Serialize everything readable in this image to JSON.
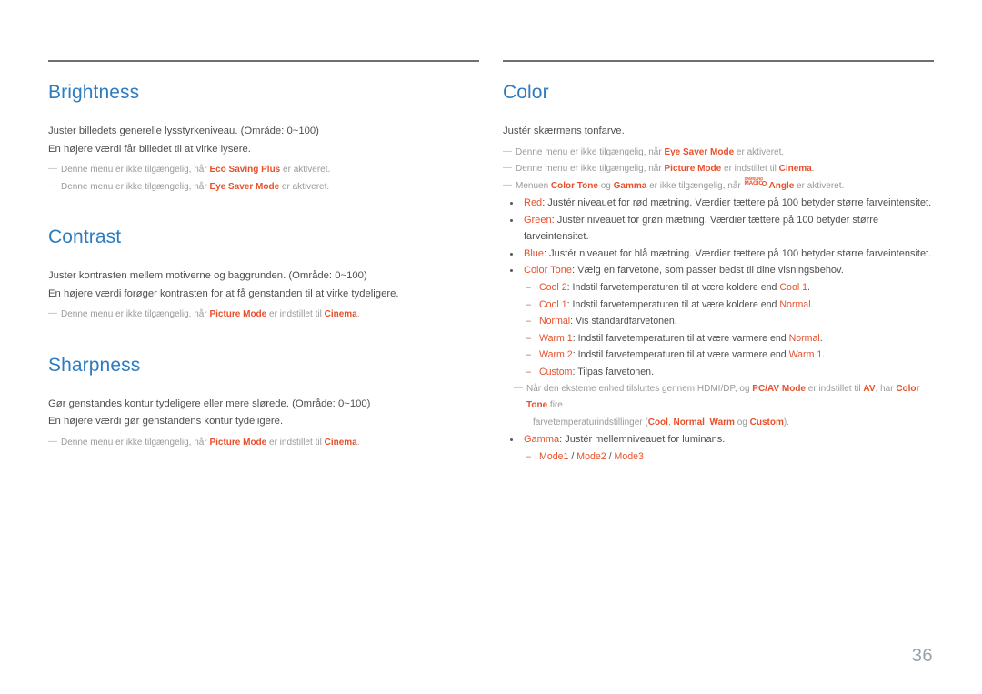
{
  "page": {
    "number": "36",
    "accent_blue": "#2e7cc0",
    "accent_orange": "#e8502b",
    "rule_color": "#6d6f71",
    "body_color": "#4f4f4f",
    "note_color": "#9a9a9a"
  },
  "left_column": {
    "sections": [
      {
        "title": "Brightness",
        "body": [
          "Juster billedets generelle lysstyrkeniveau. (Område: 0~100)",
          "En højere værdi får billedet til at virke lysere."
        ],
        "notes": [
          {
            "pre": "Denne menu er ikke tilgængelig, når ",
            "term1": "Eco Saving Plus",
            "post": " er aktiveret."
          },
          {
            "pre": "Denne menu er ikke tilgængelig, når ",
            "term1": "Eye Saver Mode",
            "post": " er aktiveret."
          }
        ]
      },
      {
        "title": "Contrast",
        "body": [
          "Juster kontrasten mellem motiverne og baggrunden. (Område: 0~100)",
          "En højere værdi forøger kontrasten for at få genstanden til at virke tydeligere."
        ],
        "notes": [
          {
            "pre": "Denne menu er ikke tilgængelig, når ",
            "term1": "Picture Mode",
            "mid": " er indstillet til ",
            "term2": "Cinema",
            "post": "."
          }
        ]
      },
      {
        "title": "Sharpness",
        "body": [
          "Gør genstandes kontur tydeligere eller mere slørede. (Område: 0~100)",
          "En højere værdi gør genstandens kontur tydeligere."
        ],
        "notes": [
          {
            "pre": "Denne menu er ikke tilgængelig, når ",
            "term1": "Picture Mode",
            "mid": " er indstillet til ",
            "term2": "Cinema",
            "post": "."
          }
        ]
      }
    ]
  },
  "right_column": {
    "title": "Color",
    "intro": "Justér skærmens tonfarve.",
    "notes": [
      {
        "pre": "Denne menu er ikke tilgængelig, når ",
        "term1": "Eye Saver Mode",
        "post": " er aktiveret."
      },
      {
        "pre": "Denne menu er ikke tilgængelig, når ",
        "term1": "Picture Mode",
        "mid": " er indstillet til ",
        "term2": "Cinema",
        "post": "."
      },
      {
        "pre": "Menuen ",
        "term1": "Color Tone",
        "mid": " og ",
        "term2": "Gamma",
        "mid2": " er ikke tilgængelig, når ",
        "logo_top": "SAMSUNG",
        "logo_bottom": "MAGIC",
        "term3": "Angle",
        "post": " er aktiveret."
      }
    ],
    "bullets": [
      {
        "term": "Red",
        "text": ": Justér niveauet for rød mætning. Værdier tættere på 100 betyder større farveintensitet."
      },
      {
        "term": "Green",
        "text": ": Justér niveauet for grøn mætning. Værdier tættere på 100 betyder større farveintensitet."
      },
      {
        "term": "Blue",
        "text": ": Justér niveauet for blå mætning. Værdier tættere på 100 betyder større farveintensitet."
      },
      {
        "term": "Color Tone",
        "text": ": Vælg en farvetone, som passer bedst til dine visningsbehov."
      }
    ],
    "color_tone_options": [
      {
        "term": "Cool 2",
        "pre": ": Indstil farvetemperaturen til at være koldere end ",
        "ref": "Cool 1",
        "post": "."
      },
      {
        "term": "Cool 1",
        "pre": ": Indstil farvetemperaturen til at være koldere end ",
        "ref": "Normal",
        "post": "."
      },
      {
        "term": "Normal",
        "pre": ": Vis standardfarvetonen.",
        "ref": "",
        "post": ""
      },
      {
        "term": "Warm 1",
        "pre": ": Indstil farvetemperaturen til at være varmere end ",
        "ref": "Normal",
        "post": "."
      },
      {
        "term": "Warm 2",
        "pre": ": Indstil farvetemperaturen til at være varmere end ",
        "ref": "Warm 1",
        "post": "."
      },
      {
        "term": "Custom",
        "pre": ": Tilpas farvetonen.",
        "ref": "",
        "post": ""
      }
    ],
    "hdmi_note": {
      "p1": "Når den eksterne enhed tilsluttes gennem HDMI/DP, og ",
      "t1": "PC/AV Mode",
      "p2": " er indstillet til ",
      "t2": "AV",
      "p3": ", har ",
      "t3": "Color Tone",
      "p4": " fire",
      "l2p1": "farvetemperaturindstillinger (",
      "l2t1": "Cool",
      "l2p2": ", ",
      "l2t2": "Normal",
      "l2p3": ", ",
      "l2t3": "Warm",
      "l2p4": " og ",
      "l2t4": "Custom",
      "l2p5": ")."
    },
    "gamma_bullet": {
      "term": "Gamma",
      "text": ": Justér mellemniveauet for luminans."
    },
    "gamma_modes": {
      "mode1": "Mode1",
      "sep1": " / ",
      "mode2": "Mode2",
      "sep2": " / ",
      "mode3": "Mode3"
    }
  }
}
